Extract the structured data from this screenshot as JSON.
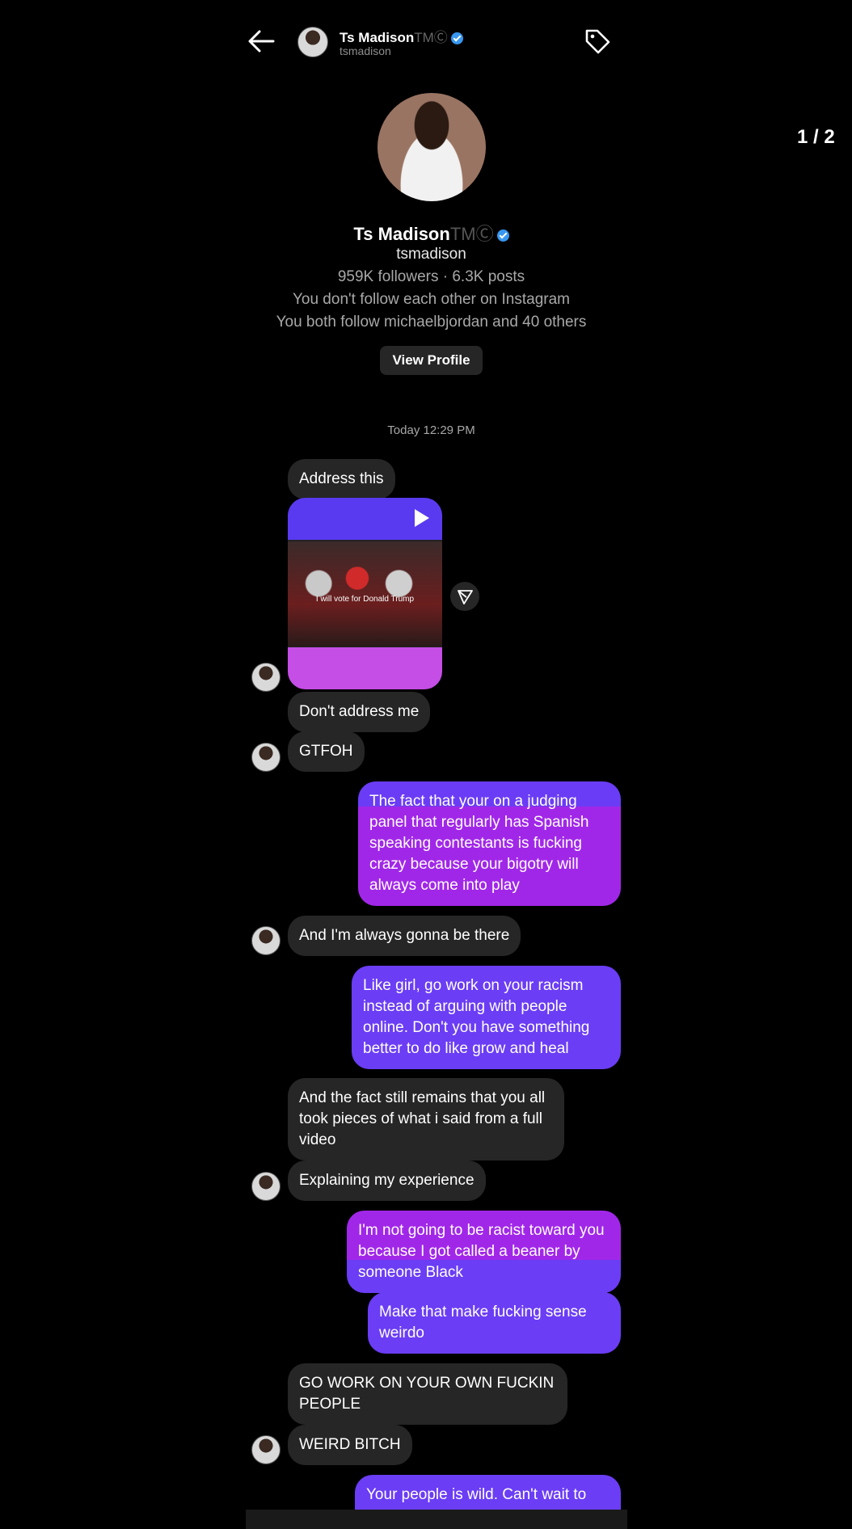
{
  "header": {
    "name": "Ts Madison",
    "trademark": "TMⒸ",
    "handle": "tsmadison"
  },
  "page_counter": "1 / 2",
  "profile": {
    "name": "Ts Madison",
    "trademark": "TMⒸ",
    "handle": "tsmadison",
    "stats": "959K followers · 6.3K posts",
    "follow_status": "You don't follow each other on Instagram",
    "mutuals": "You both follow michaelbjordan and 40 others",
    "view_profile_label": "View Profile"
  },
  "timestamp": "Today 12:29 PM",
  "video": {
    "caption": "I will vote for Donald Trump"
  },
  "messages": [
    {
      "from": "them",
      "text": "Address this"
    },
    {
      "from": "them",
      "text": "Don't address me"
    },
    {
      "from": "them",
      "text": "GTFOH"
    },
    {
      "from": "me",
      "text": "The fact that your on a judging panel that regularly has Spanish speaking contestants is fucking crazy because your bigotry will always come into play"
    },
    {
      "from": "them",
      "text": "And I'm always gonna be there"
    },
    {
      "from": "me",
      "text": "Like girl, go work on your racism instead of arguing with people online. Don't you have something better to do like grow and heal"
    },
    {
      "from": "them",
      "text": "And the fact still remains that you all took pieces of what i said from a full video"
    },
    {
      "from": "them",
      "text": "Explaining my experience"
    },
    {
      "from": "me",
      "text": "I'm not going to be racist toward you because I got called a beaner by someone Black"
    },
    {
      "from": "me",
      "text": "Make that make fucking sense weirdo"
    },
    {
      "from": "them",
      "text": "GO WORK ON YOUR OWN FUCKIN PEOPLE"
    },
    {
      "from": "them",
      "text": "WEIRD BITCH"
    },
    {
      "from": "me",
      "text": "Your people is wild. Can't wait to"
    }
  ],
  "colors": {
    "background": "#000000",
    "incoming_bubble": "#262626",
    "outgoing_bubble": "#6b3df5",
    "verified": "#3897f0"
  }
}
